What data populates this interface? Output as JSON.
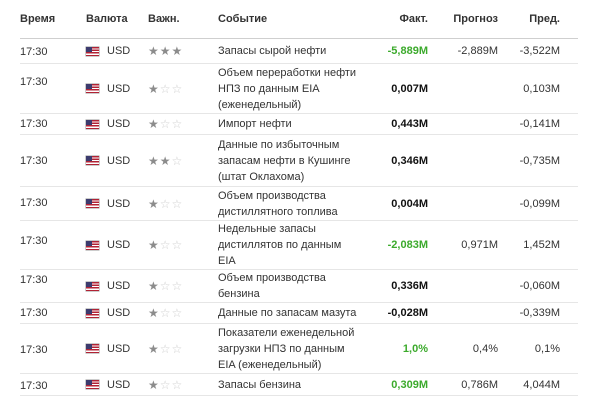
{
  "headers": {
    "time": "Время",
    "currency": "Валюта",
    "importance": "Важн.",
    "event": "Событие",
    "actual": "Факт.",
    "forecast": "Прогноз",
    "previous": "Пред."
  },
  "colors": {
    "actual_good": "#3caa2c",
    "actual_neutral": "#111111",
    "star_on": "#8c8c8c",
    "star_off": "#cfcfcf"
  },
  "rows": [
    {
      "time": "17:30",
      "currency": "USD",
      "flag": "us-flag-icon",
      "stars": 3,
      "event": "Запасы сырой нефти",
      "actual": "-5,889M",
      "actual_color": "green",
      "forecast": "-2,889M",
      "previous": "-3,522M"
    },
    {
      "time": "17:30",
      "currency": "USD",
      "flag": "us-flag-icon",
      "stars": 1,
      "event": "Объем переработки нефти НПЗ по данным EIA (еженедельный)",
      "actual": "0,007M",
      "actual_color": "black",
      "forecast": "",
      "previous": "0,103M"
    },
    {
      "time": "17:30",
      "currency": "USD",
      "flag": "us-flag-icon",
      "stars": 1,
      "event": "Импорт нефти",
      "actual": "0,443M",
      "actual_color": "black",
      "forecast": "",
      "previous": "-0,141M"
    },
    {
      "time": "17:30",
      "currency": "USD",
      "flag": "us-flag-icon",
      "stars": 2,
      "event": "Данные по избыточным запасам нефти в Кушинге (штат Оклахома)",
      "actual": "0,346M",
      "actual_color": "black",
      "forecast": "",
      "previous": "-0,735M"
    },
    {
      "time": "17:30",
      "currency": "USD",
      "flag": "us-flag-icon",
      "stars": 1,
      "event": "Объем производства дистиллятного топлива",
      "actual": "0,004M",
      "actual_color": "black",
      "forecast": "",
      "previous": "-0,099M"
    },
    {
      "time": "17:30",
      "currency": "USD",
      "flag": "us-flag-icon",
      "stars": 1,
      "event": "Недельные запасы дистиллятов по данным EIA",
      "actual": "-2,083M",
      "actual_color": "green",
      "forecast": "0,971M",
      "previous": "1,452M"
    },
    {
      "time": "17:30",
      "currency": "USD",
      "flag": "us-flag-icon",
      "stars": 1,
      "event": "Объем производства бензина",
      "actual": "0,336M",
      "actual_color": "black",
      "forecast": "",
      "previous": "-0,060M"
    },
    {
      "time": "17:30",
      "currency": "USD",
      "flag": "us-flag-icon",
      "stars": 1,
      "event": "Данные по запасам мазута",
      "actual": "-0,028M",
      "actual_color": "black",
      "forecast": "",
      "previous": "-0,339M"
    },
    {
      "time": "17:30",
      "currency": "USD",
      "flag": "us-flag-icon",
      "stars": 1,
      "event": "Показатели еженедельной загрузки НПЗ по данным EIA (еженедельный)",
      "actual": "1,0%",
      "actual_color": "green",
      "forecast": "0,4%",
      "previous": "0,1%"
    },
    {
      "time": "17:30",
      "currency": "USD",
      "flag": "us-flag-icon",
      "stars": 1,
      "event": "Запасы бензина",
      "actual": "0,309M",
      "actual_color": "green",
      "forecast": "0,786M",
      "previous": "4,044M"
    }
  ]
}
